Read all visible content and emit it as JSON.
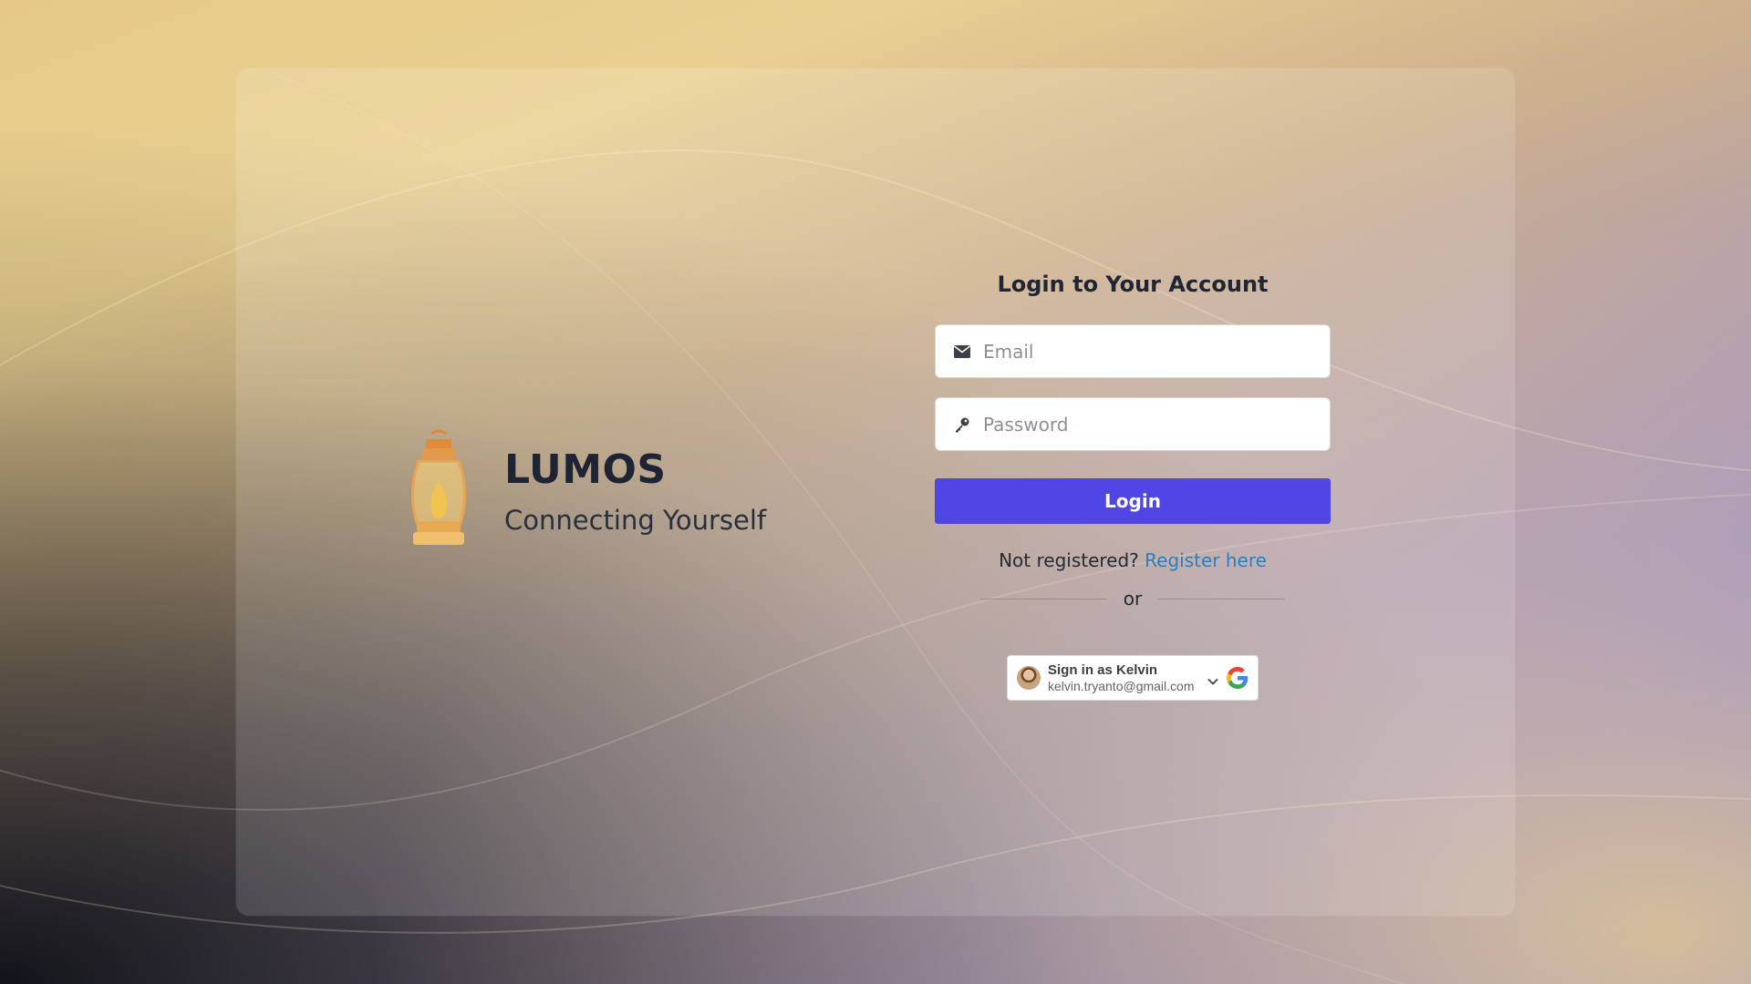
{
  "brand": {
    "title": "LUMOS",
    "tagline": "Connecting Yourself"
  },
  "login": {
    "heading": "Login to Your Account",
    "email_placeholder": "Email",
    "password_placeholder": "Password",
    "login_label": "Login",
    "not_registered_text": "Not registered?",
    "register_link_label": "Register here",
    "divider_text": "or"
  },
  "google_signin": {
    "title": "Sign in as Kelvin",
    "email": "kelvin.tryanto@gmail.com"
  },
  "colors": {
    "primary_button": "#4f46e5",
    "link": "#2b7fbf",
    "heading_text": "#1f2533"
  },
  "icons": {
    "email": "envelope-icon",
    "password": "key-icon",
    "brand": "lantern-icon",
    "google": "google-icon",
    "chevron": "chevron-down-icon"
  }
}
